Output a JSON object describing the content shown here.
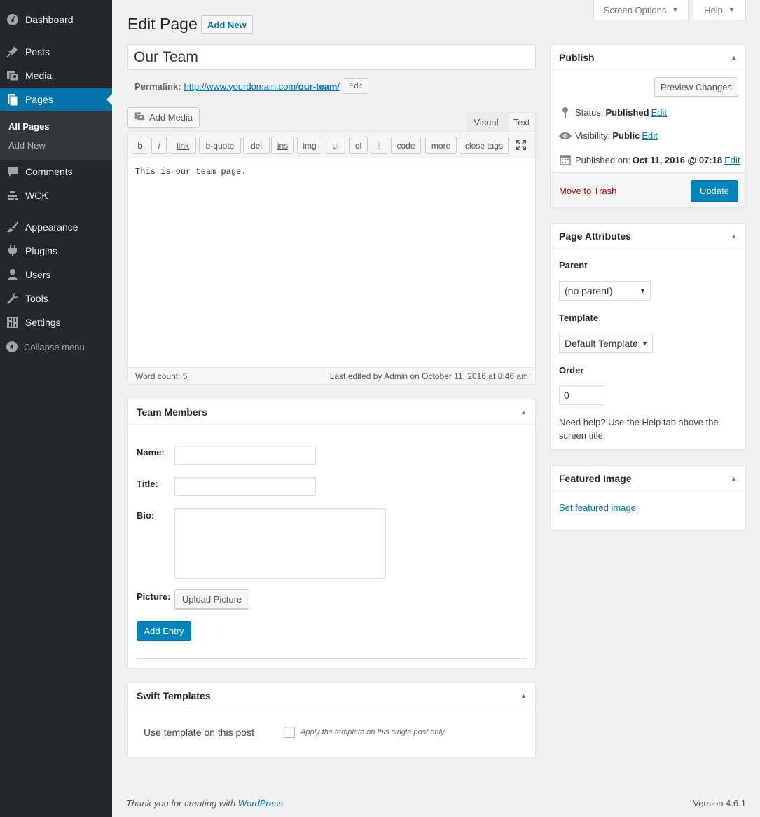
{
  "sidebar": {
    "dashboard": "Dashboard",
    "posts": "Posts",
    "media": "Media",
    "pages": "Pages",
    "all_pages": "All Pages",
    "add_new": "Add New",
    "comments": "Comments",
    "wck": "WCK",
    "appearance": "Appearance",
    "plugins": "Plugins",
    "users": "Users",
    "tools": "Tools",
    "settings": "Settings",
    "collapse": "Collapse menu"
  },
  "top": {
    "screen_options": "Screen Options",
    "help": "Help"
  },
  "header": {
    "title": "Edit Page",
    "add_new": "Add New"
  },
  "post": {
    "title_value": "Our Team",
    "permalink_label": "Permalink:",
    "permalink_base": "http://www.yourdomain.com/",
    "permalink_slug": "our-team",
    "permalink_trail": "/",
    "permalink_edit": "Edit"
  },
  "editor": {
    "add_media": "Add Media",
    "tab_visual": "Visual",
    "tab_text": "Text",
    "buttons": [
      "b",
      "i",
      "link",
      "b-quote",
      "del",
      "ins",
      "img",
      "ul",
      "ol",
      "li",
      "code",
      "more",
      "close tags"
    ],
    "content": "This is our team page.",
    "word_count": "Word count: 5",
    "last_edited": "Last edited by Admin on October 11, 2016 at 8:46 am"
  },
  "team_members": {
    "title": "Team Members",
    "name_label": "Name:",
    "title_label": "Title:",
    "bio_label": "Bio:",
    "picture_label": "Picture:",
    "upload_button": "Upload Picture",
    "add_entry": "Add Entry"
  },
  "swift": {
    "title": "Swift Templates",
    "use_label": "Use template on this post",
    "apply_label": "Apply the template on this single post only"
  },
  "publish": {
    "title": "Publish",
    "preview": "Preview Changes",
    "status_label": "Status:",
    "status_value": "Published",
    "visibility_label": "Visibility:",
    "visibility_value": "Public",
    "published_label": "Published on:",
    "published_value": "Oct 11, 2016 @ 07:18",
    "edit": "Edit",
    "trash": "Move to Trash",
    "update": "Update"
  },
  "attributes": {
    "title": "Page Attributes",
    "parent_label": "Parent",
    "parent_value": "(no parent)",
    "template_label": "Template",
    "template_value": "Default Template",
    "order_label": "Order",
    "order_value": "0",
    "help_text": "Need help? Use the Help tab above the screen title."
  },
  "featured": {
    "title": "Featured Image",
    "link": "Set featured image"
  },
  "footer": {
    "thanks": "Thank you for creating with ",
    "wordpress": "WordPress",
    "period": ".",
    "version": "Version 4.6.1"
  },
  "colors": {
    "sidebar": "#23282d",
    "accent": "#0073aa",
    "primary_button": "#0085ba",
    "trash": "#a00"
  }
}
